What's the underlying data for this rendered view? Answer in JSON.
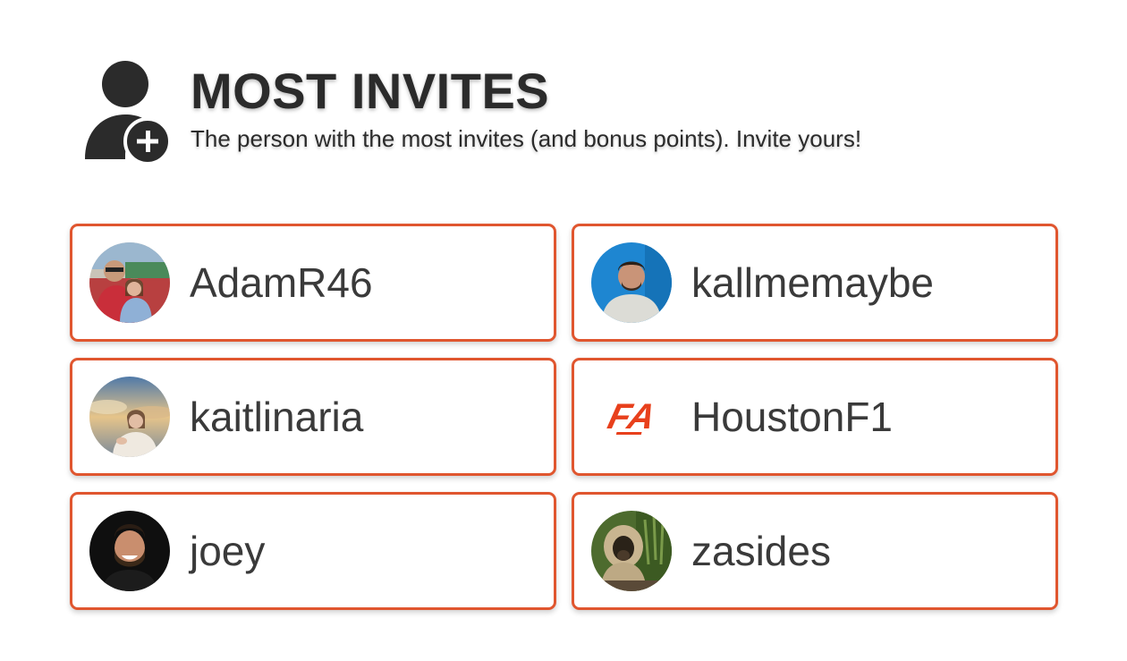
{
  "header": {
    "title": "MOST INVITES",
    "subtitle": "The person with the most invites (and bonus points). Invite yours!",
    "icon": "user-plus-icon"
  },
  "colors": {
    "card_border": "#e0562f",
    "text": "#2b2b2b"
  },
  "invitees": [
    {
      "username": "AdamR46",
      "avatar": "couple-photo-avatar"
    },
    {
      "username": "kallmemaybe",
      "avatar": "man-blue-background-avatar"
    },
    {
      "username": "kaitlinaria",
      "avatar": "woman-sunset-avatar"
    },
    {
      "username": "HoustonF1",
      "avatar": "fa-logo-avatar",
      "logo_text": "FA"
    },
    {
      "username": "joey",
      "avatar": "smiling-man-dark-avatar"
    },
    {
      "username": "zasides",
      "avatar": "gibbon-avatar"
    }
  ]
}
